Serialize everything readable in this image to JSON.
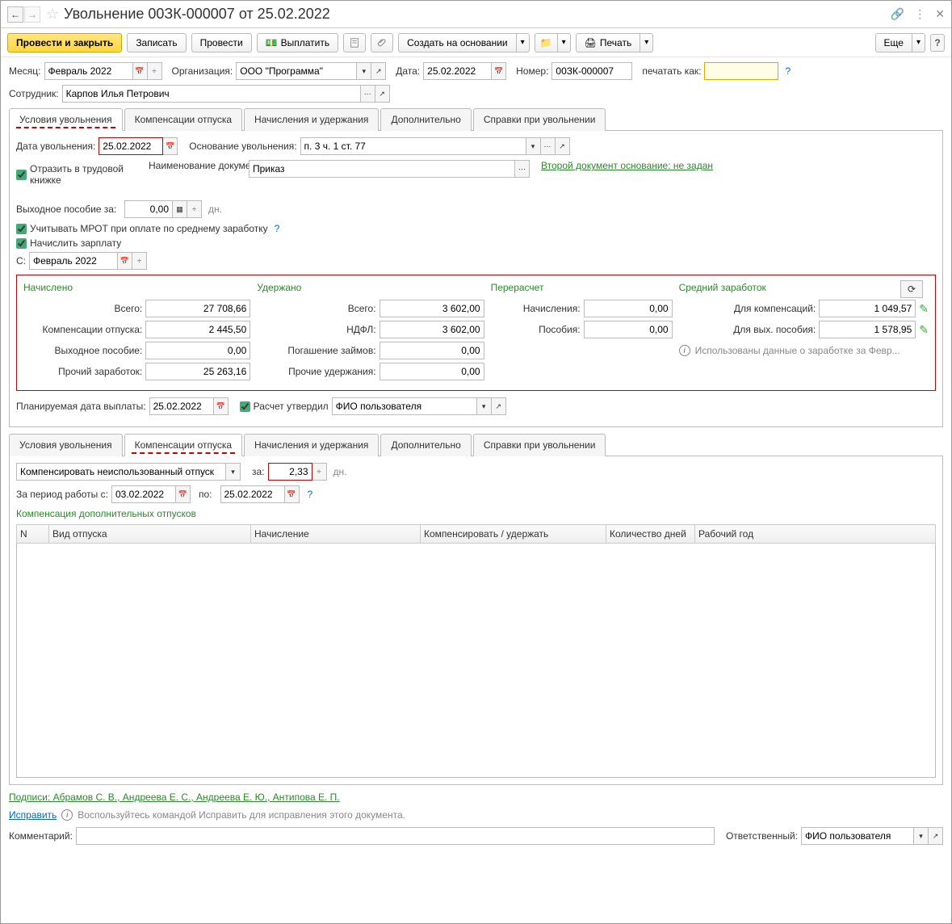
{
  "title": "Увольнение 00ЗК-000007 от 25.02.2022",
  "toolbar": {
    "post_close": "Провести и закрыть",
    "write": "Записать",
    "post": "Провести",
    "pay": "Выплатить",
    "create_based": "Создать на основании",
    "print": "Печать",
    "more": "Еще"
  },
  "header": {
    "month_label": "Месяц:",
    "month": "Февраль 2022",
    "org_label": "Организация:",
    "org": "ООО \"Программа\"",
    "date_label": "Дата:",
    "date": "25.02.2022",
    "number_label": "Номер:",
    "number": "00ЗК-000007",
    "print_as_label": "печатать как:",
    "print_as": "",
    "employee_label": "Сотрудник:",
    "employee": "Карпов Илья Петрович"
  },
  "tabs1": [
    "Условия увольнения",
    "Компенсации отпуска",
    "Начисления и удержания",
    "Дополнительно",
    "Справки при увольнении"
  ],
  "conditions": {
    "dismiss_date_label": "Дата увольнения:",
    "dismiss_date": "25.02.2022",
    "reason_label": "Основание увольнения:",
    "reason": "п. 3 ч. 1 ст. 77",
    "workbook_label": "Отразить в трудовой книжке",
    "doc_name_label": "Наименование документа:",
    "doc_name": "Приказ",
    "second_doc_link": "Второй документ основание: не задан",
    "severance_label": "Выходное пособие за:",
    "severance_val": "0,00",
    "days_unit": "дн.",
    "mrot_label": "Учитывать МРОТ при оплате по среднему заработку",
    "accrue_salary_label": "Начислить зарплату",
    "from_label": "С:",
    "from_month": "Февраль 2022"
  },
  "calc": {
    "accrued_hdr": "Начислено",
    "withheld_hdr": "Удержано",
    "recalc_hdr": "Перерасчет",
    "avg_hdr": "Средний заработок",
    "rows": {
      "total": "Всего:",
      "total_acc": "27 708,66",
      "comp_vac": "Компенсации отпуска:",
      "comp_vac_v": "2 445,50",
      "severance": "Выходное пособие:",
      "severance_v": "0,00",
      "other_inc": "Прочий заработок:",
      "other_inc_v": "25 263,16",
      "total_w": "Всего:",
      "total_w_v": "3 602,00",
      "ndfl": "НДФЛ:",
      "ndfl_v": "3 602,00",
      "loan": "Погашение займов:",
      "loan_v": "0,00",
      "other_w": "Прочие удержания:",
      "other_w_v": "0,00",
      "recalc_acc": "Начисления:",
      "recalc_acc_v": "0,00",
      "recalc_ben": "Пособия:",
      "recalc_ben_v": "0,00",
      "avg_comp": "Для компенсаций:",
      "avg_comp_v": "1 049,57",
      "avg_sev": "Для вых. пособия:",
      "avg_sev_v": "1 578,95",
      "info_text": "Использованы данные о заработке за Февр..."
    },
    "pay_date_label": "Планируемая дата выплаты:",
    "pay_date": "25.02.2022",
    "approved_label": "Расчет утвердил",
    "approved_by": "ФИО пользователя"
  },
  "tabs2": [
    "Условия увольнения",
    "Компенсации отпуска",
    "Начисления и удержания",
    "Дополнительно",
    "Справки при увольнении"
  ],
  "comp": {
    "action": "Компенсировать неиспользованный отпуск",
    "for_label": "за:",
    "days": "2,33",
    "days_unit": "дн.",
    "period_label": "За период работы с:",
    "from": "03.02.2022",
    "to_label": "по:",
    "to": "25.02.2022",
    "extra_title": "Компенсация дополнительных отпусков",
    "cols": [
      "N",
      "Вид отпуска",
      "Начисление",
      "Компенсировать / удержать",
      "Количество дней",
      "Рабочий год"
    ]
  },
  "footer": {
    "signatures": "Подписи: Абрамов С. В., Андреева Е. С., Андреева Е. Ю., Антипова Е. П.",
    "fix_link": "Исправить",
    "fix_text": "Воспользуйтесь командой Исправить для исправления этого документа.",
    "comment_label": "Комментарий:",
    "responsible_label": "Ответственный:",
    "responsible": "ФИО пользователя"
  }
}
